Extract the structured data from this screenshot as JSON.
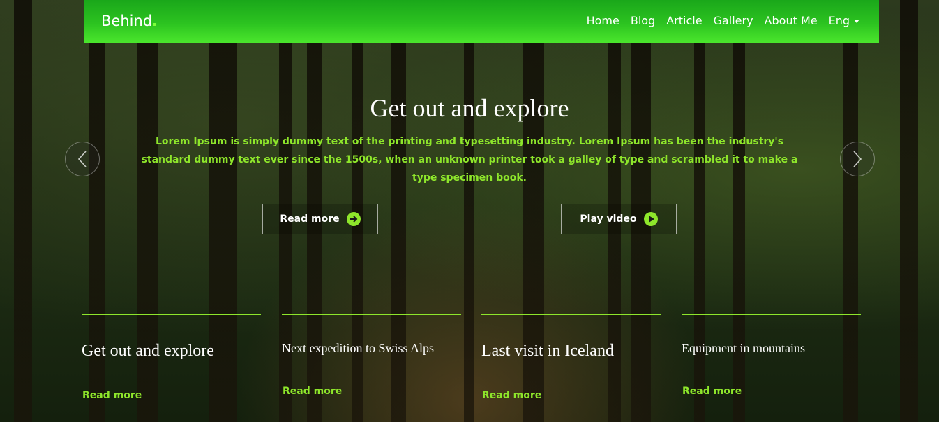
{
  "navbar": {
    "brand": "Behind",
    "links": [
      "Home",
      "Blog",
      "Article",
      "Gallery",
      "About Me"
    ],
    "language": "Eng"
  },
  "hero": {
    "title": "Get out and explore",
    "text": "Lorem Ipsum is simply dummy text of the printing and typesetting industry. Lorem Ipsum has been the industry's standard dummy text ever since the 1500s, when an unknown printer took a galley of type and scrambled it to make a type specimen book.",
    "read_more": "Read more",
    "play_video": "Play video"
  },
  "cards": [
    {
      "title": "Get out and explore",
      "link": "Read more"
    },
    {
      "title": "Next expedition to Swiss Alps",
      "link": "Read more"
    },
    {
      "title": "Last visit in Iceland",
      "link": "Read more"
    },
    {
      "title": "Equipment in mountains",
      "link": "Read more"
    }
  ],
  "colors": {
    "accent": "#8ee62b",
    "navbar": "#2cc320"
  }
}
